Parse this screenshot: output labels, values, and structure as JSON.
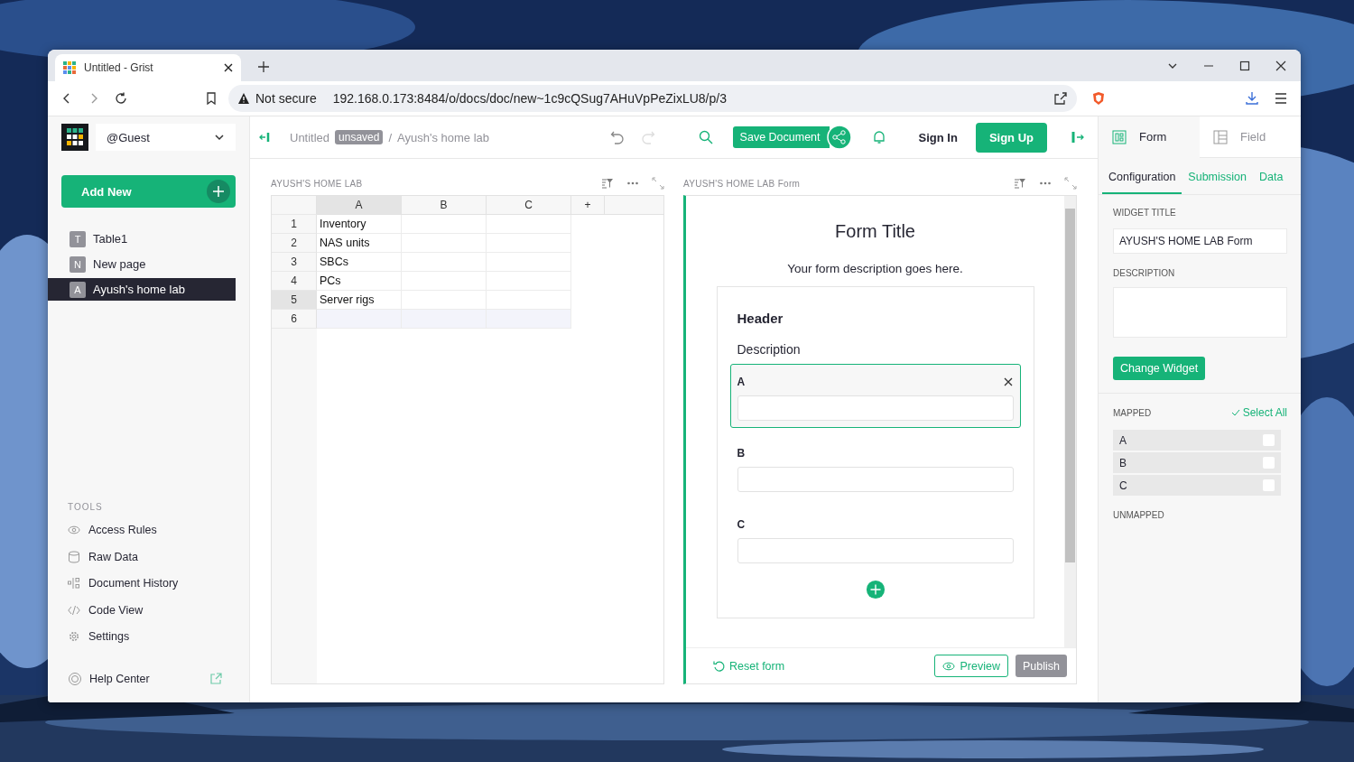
{
  "browser": {
    "tabs": [
      {
        "title": "Untitled - Grist",
        "selected": true
      }
    ],
    "security": "Not secure",
    "url": "192.168.0.173:8484/o/docs/doc/new~1c9cQSug7AHuVpPeZixLU8/p/3"
  },
  "sidebar": {
    "account": "@Guest",
    "add_new": "Add New",
    "pages": [
      {
        "initial": "T",
        "label": "Table1",
        "selected": false
      },
      {
        "initial": "N",
        "label": "New page",
        "selected": false
      },
      {
        "initial": "A",
        "label": "Ayush's home lab",
        "selected": true
      }
    ],
    "tools_heading": "TOOLS",
    "tools": [
      {
        "kind": "access",
        "label": "Access Rules"
      },
      {
        "kind": "raw",
        "label": "Raw Data"
      },
      {
        "kind": "history",
        "label": "Document History"
      },
      {
        "kind": "code",
        "label": "Code View"
      },
      {
        "kind": "settings",
        "label": "Settings"
      }
    ],
    "help": "Help Center"
  },
  "topbar": {
    "doc": "Untitled",
    "badge": "unsaved",
    "separator": "/",
    "page": "Ayush's home lab",
    "save": "Save Document",
    "sign_in": "Sign In",
    "sign_up": "Sign Up"
  },
  "grid": {
    "title": "AYUSH'S HOME LAB",
    "columns": [
      {
        "label": "A",
        "selected": true
      },
      {
        "label": "B",
        "selected": false
      },
      {
        "label": "C",
        "selected": false
      }
    ],
    "add_column": "+",
    "rows": [
      {
        "number": "1",
        "value": "Inventory",
        "selected": false,
        "kind": "record"
      },
      {
        "number": "2",
        "value": "NAS units",
        "selected": false,
        "kind": "record"
      },
      {
        "number": "3",
        "value": "SBCs",
        "selected": false,
        "kind": "record"
      },
      {
        "number": "4",
        "value": "PCs",
        "selected": false,
        "kind": "record"
      },
      {
        "number": "5",
        "value": "Server rigs",
        "selected": true,
        "kind": "record"
      },
      {
        "number": "6",
        "selected": false,
        "kind": "new"
      }
    ]
  },
  "form_widget": {
    "title": "AYUSH'S HOME LAB Form",
    "form_title": "Form Title",
    "description": "Your form description goes here.",
    "section": {
      "header": "Header",
      "description": "Description"
    },
    "fields": [
      {
        "label": "A",
        "selected": true
      },
      {
        "label": "B",
        "selected": false
      },
      {
        "label": "C",
        "selected": false
      }
    ],
    "reset": "Reset form",
    "preview": "Preview",
    "publish": "Publish"
  },
  "right_panel": {
    "tabs": [
      {
        "kind": "form",
        "label": "Form",
        "selected": true
      },
      {
        "kind": "field",
        "label": "Field",
        "selected": false
      }
    ],
    "subtabs": [
      {
        "label": "Configuration",
        "selected": true
      },
      {
        "label": "Submission",
        "selected": false
      },
      {
        "label": "Data",
        "selected": false
      }
    ],
    "widget_title_label": "WIDGET TITLE",
    "widget_title": "AYUSH'S HOME LAB Form",
    "description_label": "DESCRIPTION",
    "change_widget": "Change Widget",
    "mapped_label": "MAPPED",
    "select_all": "Select All",
    "mapped": [
      {
        "label": "A",
        "checked": false
      },
      {
        "label": "B",
        "checked": false
      },
      {
        "label": "C",
        "checked": false
      }
    ],
    "unmapped_label": "UNMAPPED"
  }
}
